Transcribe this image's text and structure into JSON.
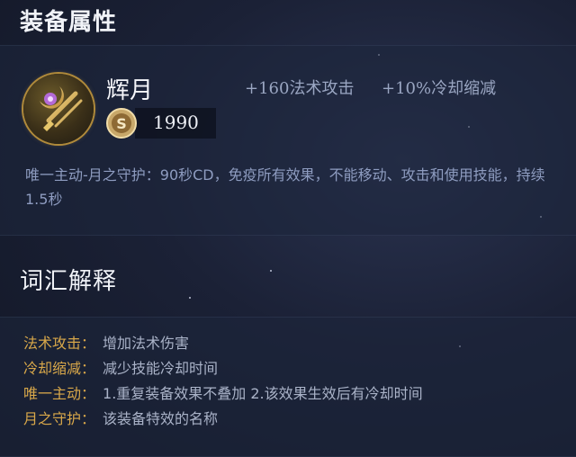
{
  "section_attributes": {
    "title": "装备属性"
  },
  "item": {
    "name": "辉月",
    "icon": "moon-scepter-icon",
    "stats": [
      "+160法术攻击",
      "+10%冷却缩减"
    ],
    "price_icon": "gold-coin-icon",
    "price": "1990",
    "description": "唯一主动-月之守护：90秒CD，免疫所有效果，不能移动、攻击和使用技能，持续1.5秒"
  },
  "section_glossary": {
    "title": "词汇解释"
  },
  "glossary": [
    {
      "term": "法术攻击：",
      "definition": "增加法术伤害"
    },
    {
      "term": "冷却缩减：",
      "definition": "减少技能冷却时间"
    },
    {
      "term": "唯一主动：",
      "definition": "1.重复装备效果不叠加 2.该效果生效后有冷却时间"
    },
    {
      "term": "月之守护：",
      "definition": "该装备特效的名称"
    }
  ],
  "colors": {
    "term": "#d9a84a",
    "definition": "#aab3c8",
    "title": "#f1f3f8",
    "description": "#8e9cc0",
    "stat": "#9aa6c2"
  }
}
